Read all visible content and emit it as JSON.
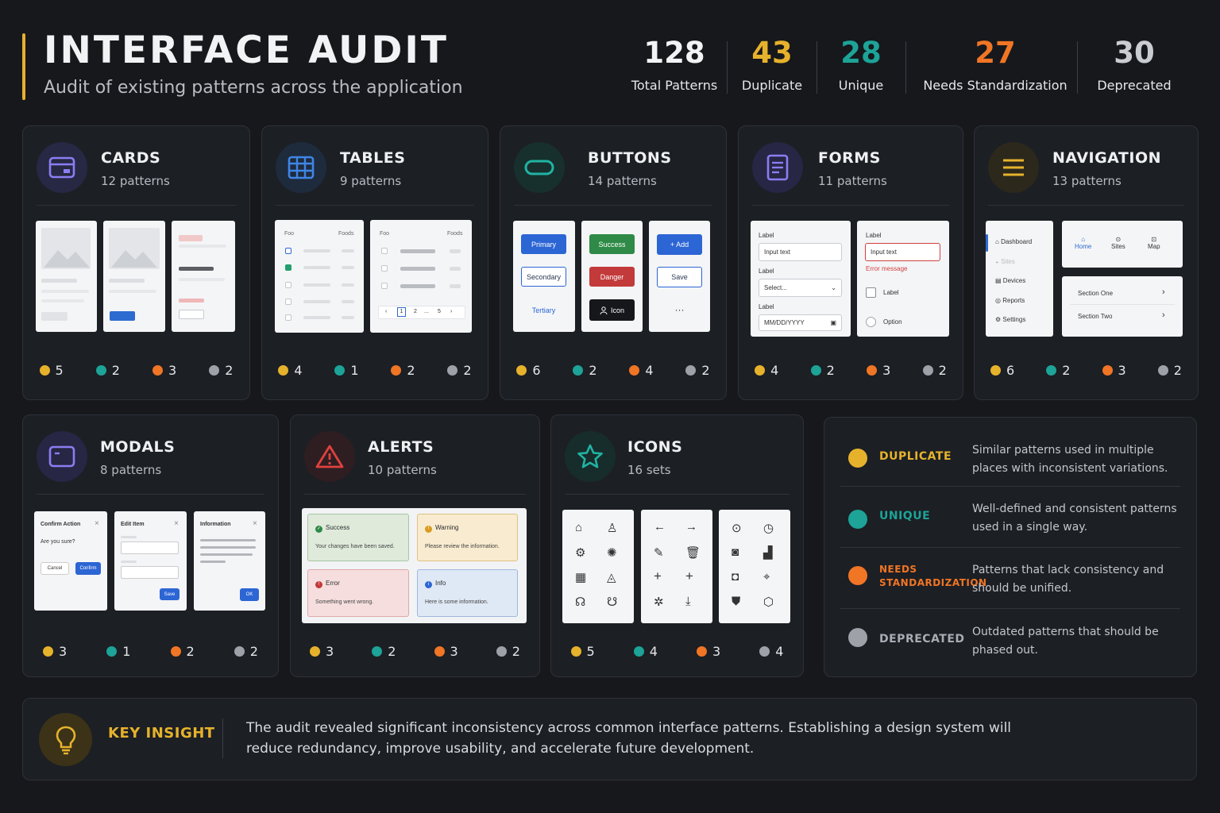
{
  "header": {
    "title": "INTERFACE AUDIT",
    "subtitle": "Audit of existing patterns across the application"
  },
  "stats": [
    {
      "value": "128",
      "label": "Total Patterns",
      "color": "#f2f3f5"
    },
    {
      "value": "43",
      "label": "Duplicate",
      "color": "#e6b22c"
    },
    {
      "value": "28",
      "label": "Unique",
      "color": "#1da398"
    },
    {
      "value": "27",
      "label": "Needs Standardization",
      "color": "#f07525"
    },
    {
      "value": "30",
      "label": "Deprecated",
      "color": "#c9ccd1"
    }
  ],
  "categories": {
    "cards": {
      "title": "CARDS",
      "sub": "12 patterns",
      "icon": "card-icon",
      "counts": [
        "5",
        "2",
        "3",
        "2"
      ]
    },
    "tables": {
      "title": "TABLES",
      "sub": "9 patterns",
      "icon": "table-icon",
      "counts": [
        "4",
        "1",
        "2",
        "2"
      ]
    },
    "buttons": {
      "title": "BUTTONS",
      "sub": "14 patterns",
      "icon": "button-icon",
      "counts": [
        "6",
        "2",
        "4",
        "2"
      ]
    },
    "forms": {
      "title": "FORMS",
      "sub": "11 patterns",
      "icon": "form-icon",
      "counts": [
        "4",
        "2",
        "3",
        "2"
      ]
    },
    "navigation": {
      "title": "NAVIGATION",
      "sub": "13 patterns",
      "icon": "menu-icon",
      "counts": [
        "6",
        "2",
        "3",
        "2"
      ]
    },
    "modals": {
      "title": "MODALS",
      "sub": "8 patterns",
      "icon": "modal-icon",
      "counts": [
        "3",
        "1",
        "2",
        "2"
      ]
    },
    "alerts": {
      "title": "ALERTS",
      "sub": "10 patterns",
      "icon": "warning-icon",
      "counts": [
        "3",
        "2",
        "3",
        "2"
      ]
    },
    "icons": {
      "title": "ICONS",
      "sub": "16 sets",
      "icon": "star-icon",
      "counts": [
        "5",
        "4",
        "3",
        "4"
      ]
    }
  },
  "previews": {
    "table_header_left": "Foo",
    "table_header_right": "Foods",
    "pagination": [
      "‹",
      "1",
      "2",
      "...",
      "5",
      "›"
    ],
    "buttons": {
      "primary": "Primary",
      "secondary": "Secondary",
      "tertiary": "Tertiary",
      "success": "Success",
      "danger": "Danger",
      "icon": "Icon",
      "add": "+ Add",
      "save": "Save",
      "more": "···"
    },
    "forms": {
      "label": "Label",
      "input_text": "Input text",
      "select": "Select...",
      "date": "MM/DD/YYYY",
      "error": "Error message",
      "checkbox_label": "Label",
      "radio_label": "Option"
    },
    "nav": {
      "items": [
        "Dashboard",
        "Sites",
        "Devices",
        "Reports",
        "Settings"
      ],
      "tabs": [
        "Home",
        "Sites",
        "Map"
      ],
      "sections": [
        "Section One",
        "Section Two"
      ]
    },
    "modals": {
      "confirm_title": "Confirm Action",
      "confirm_body": "Are you sure?",
      "cancel": "Cancel",
      "confirm": "Confirm",
      "edit_title": "Edit Item",
      "save": "Save",
      "info_title": "Information",
      "ok": "OK"
    },
    "alerts": {
      "success_title": "Success",
      "success_body": "Your changes have been saved.",
      "warning_title": "Warning",
      "warning_body": "Please review the information.",
      "error_title": "Error",
      "error_body": "Something went wrong.",
      "info_title": "Info",
      "info_body": "Here is some information."
    }
  },
  "legend": [
    {
      "name": "DUPLICATE",
      "desc": "Similar patterns used in multiple places with inconsistent variations.",
      "color": "#e6b22c"
    },
    {
      "name": "UNIQUE",
      "desc": "Well-defined and consistent patterns used in a single way.",
      "color": "#1da398"
    },
    {
      "name": "NEEDS STANDARDIZATION",
      "desc": "Patterns that lack consistency and should be unified.",
      "color": "#f07525"
    },
    {
      "name": "DEPRECATED",
      "desc": "Outdated patterns that should be phased out.",
      "color": "#9ea2a8"
    }
  ],
  "insight": {
    "title": "KEY INSIGHT",
    "text": "The audit revealed significant inconsistency across common interface patterns. Establishing a design system will reduce redundancy, improve usability, and accelerate future development.",
    "icon": "lightbulb-icon"
  }
}
